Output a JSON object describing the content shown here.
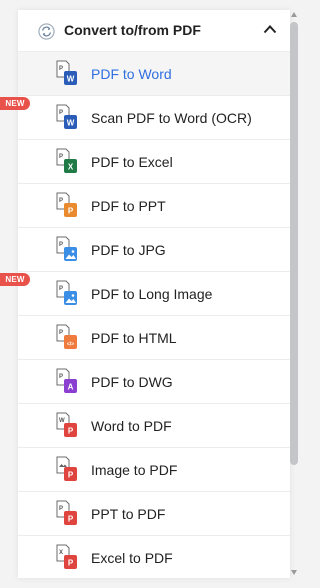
{
  "header": {
    "title": "Convert to/from PDF"
  },
  "badge_text": "NEW",
  "items": [
    {
      "label": "PDF to Word",
      "icon": "pdf-to-word-icon",
      "accent": "#2b5db8",
      "letter": "W",
      "new": false,
      "selected": true
    },
    {
      "label": "Scan PDF to Word (OCR)",
      "icon": "scan-ocr-word-icon",
      "accent": "#2b5db8",
      "letter": "W",
      "new": true,
      "selected": false
    },
    {
      "label": "PDF to Excel",
      "icon": "pdf-to-excel-icon",
      "accent": "#1f7a45",
      "letter": "X",
      "new": false,
      "selected": false
    },
    {
      "label": "PDF to PPT",
      "icon": "pdf-to-ppt-icon",
      "accent": "#e98a2e",
      "letter": "P",
      "new": false,
      "selected": false
    },
    {
      "label": "PDF to JPG",
      "icon": "pdf-to-jpg-icon",
      "accent": "#3a8ee6",
      "letter": "",
      "new": false,
      "selected": false
    },
    {
      "label": "PDF to Long Image",
      "icon": "pdf-to-long-image-icon",
      "accent": "#3a8ee6",
      "letter": "",
      "new": true,
      "selected": false
    },
    {
      "label": "PDF to HTML",
      "icon": "pdf-to-html-icon",
      "accent": "#ef7b3e",
      "letter": "</>",
      "new": false,
      "selected": false
    },
    {
      "label": "PDF to DWG",
      "icon": "pdf-to-dwg-icon",
      "accent": "#8a3fd1",
      "letter": "A",
      "new": false,
      "selected": false
    },
    {
      "label": "Word to PDF",
      "icon": "word-to-pdf-icon",
      "accent": "#e0443e",
      "letter": "P",
      "new": false,
      "selected": false
    },
    {
      "label": "Image to PDF",
      "icon": "image-to-pdf-icon",
      "accent": "#e0443e",
      "letter": "P",
      "new": false,
      "selected": false
    },
    {
      "label": "PPT to PDF",
      "icon": "ppt-to-pdf-icon",
      "accent": "#e0443e",
      "letter": "P",
      "new": false,
      "selected": false
    },
    {
      "label": "Excel to PDF",
      "icon": "excel-to-pdf-icon",
      "accent": "#e0443e",
      "letter": "P",
      "new": false,
      "selected": false
    }
  ],
  "colors": {
    "accent": "#2f6fe0",
    "badge": "#e8524a",
    "text": "#222222"
  }
}
